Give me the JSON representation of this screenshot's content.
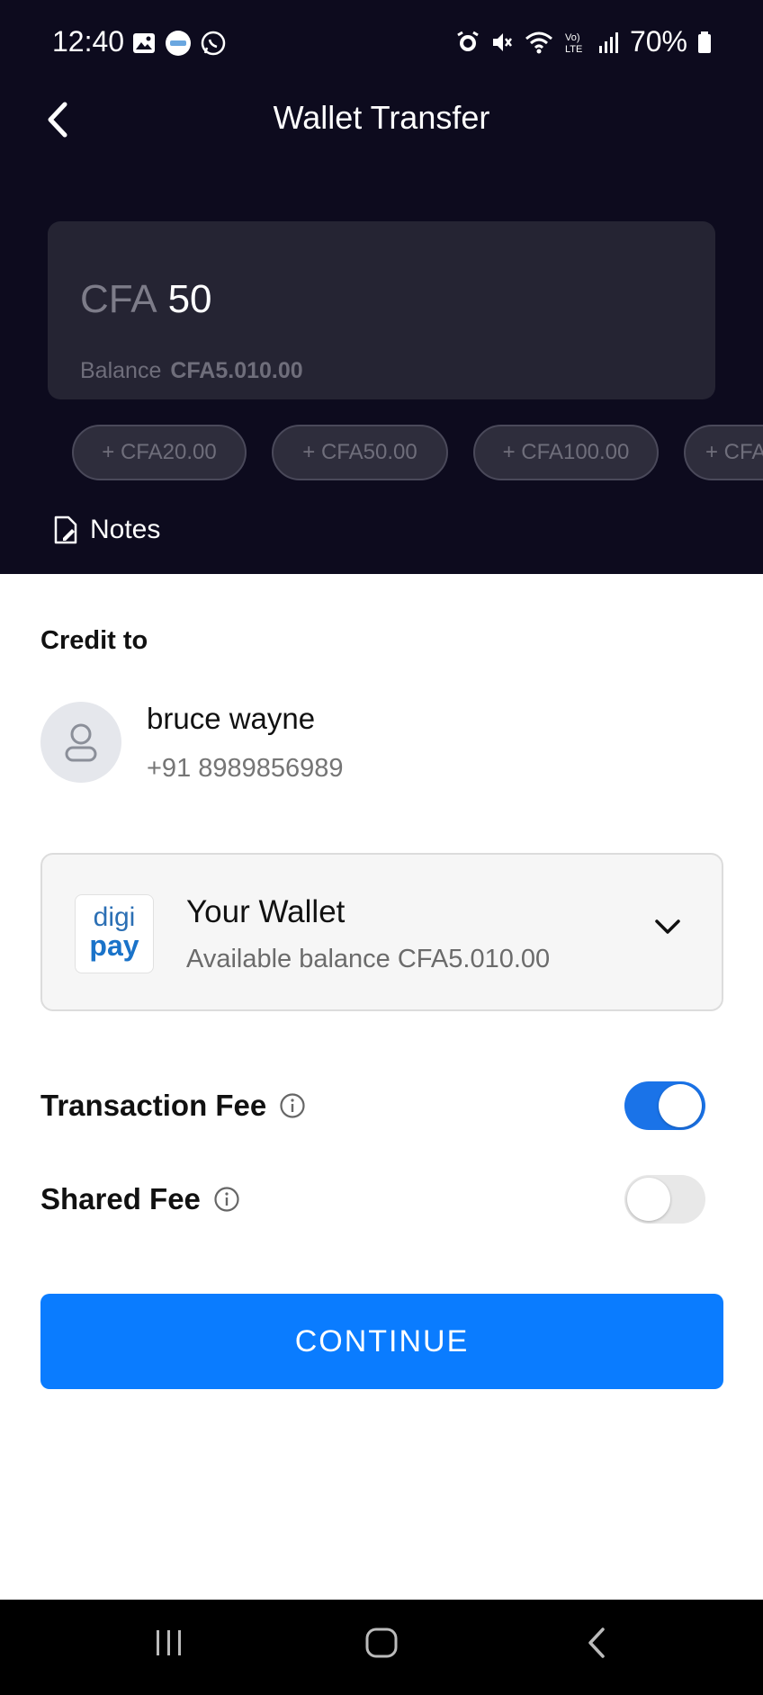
{
  "status_bar": {
    "time": "12:40",
    "battery": "70%",
    "left_icons": [
      "gallery-icon",
      "digipay-notification-icon",
      "whatsapp-icon"
    ],
    "right_icons": [
      "alarm-icon",
      "mute-icon",
      "wifi-icon",
      "volte-icon",
      "signal-icon",
      "battery-icon"
    ]
  },
  "header": {
    "title": "Wallet Transfer",
    "back_icon": "chevron-left-icon"
  },
  "amount": {
    "currency": "CFA",
    "value": "50",
    "balance_label": "Balance",
    "balance_value": "CFA5.010.00"
  },
  "quick_amounts": [
    "+ CFA20.00",
    "+ CFA50.00",
    "+ CFA100.00",
    "+ CFA"
  ],
  "notes": {
    "label": "Notes",
    "icon": "note-edit-icon"
  },
  "credit_to": {
    "label": "Credit to",
    "name": "bruce wayne",
    "phone": "+91 8989856989"
  },
  "wallet": {
    "logo_top": "digi",
    "logo_bottom": "pay",
    "title": "Your Wallet",
    "subtitle": "Available balance CFA5.010.00"
  },
  "fees": [
    {
      "label": "Transaction Fee",
      "enabled": true
    },
    {
      "label": "Shared Fee",
      "enabled": false
    }
  ],
  "continue_label": "CONTINUE",
  "colors": {
    "top_background": "#0d0b1e",
    "primary": "#0a7cff",
    "toggle_on": "#1a73e8"
  }
}
